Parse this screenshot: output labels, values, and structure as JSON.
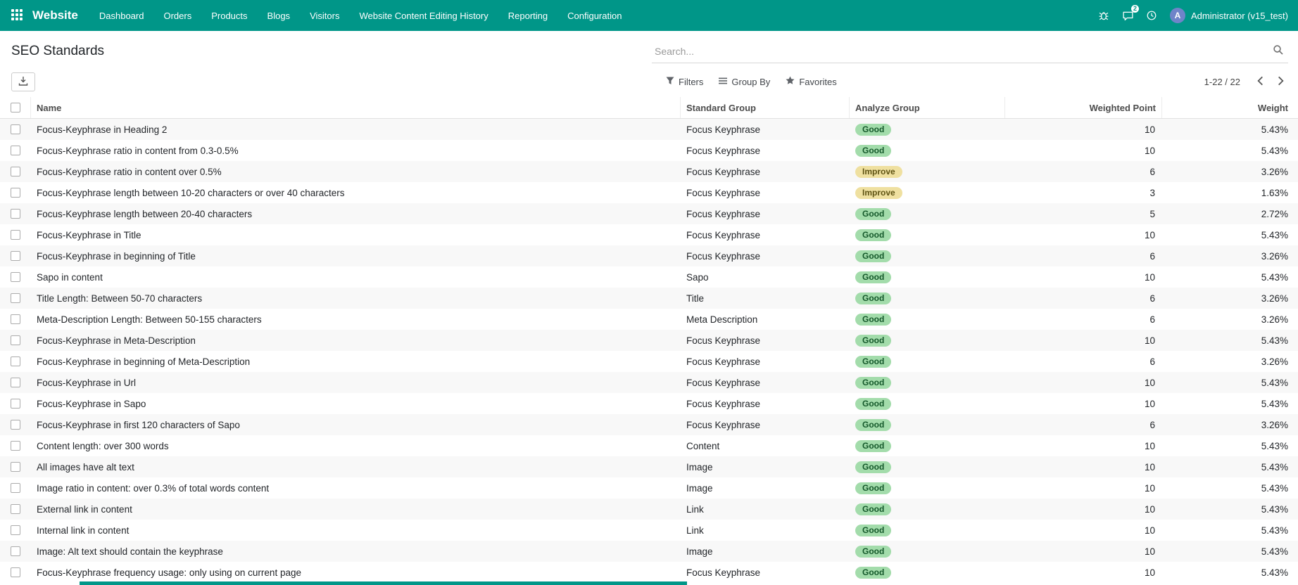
{
  "colors": {
    "accent": "#009688",
    "good_bg": "#a3dcab",
    "good_text": "#14582a",
    "improve_bg": "#efe0a0",
    "improve_text": "#5f5313"
  },
  "nav": {
    "brand": "Website",
    "items": [
      "Dashboard",
      "Orders",
      "Products",
      "Blogs",
      "Visitors",
      "Website Content Editing History",
      "Reporting",
      "Configuration"
    ],
    "message_count": "2",
    "avatar_letter": "A",
    "user": "Administrator (v15_test)"
  },
  "control_panel": {
    "title": "SEO Standards",
    "search_placeholder": "Search...",
    "filters": "Filters",
    "group_by": "Group By",
    "favorites": "Favorites",
    "pager": "1-22 / 22"
  },
  "table": {
    "columns": [
      "Name",
      "Standard Group",
      "Analyze Group",
      "Weighted Point",
      "Weight"
    ],
    "rows": [
      {
        "name": "Focus-Keyphrase in Heading 2",
        "group": "Focus Keyphrase",
        "analyze": "Good",
        "type": "good",
        "point": "10",
        "weight": "5.43%"
      },
      {
        "name": "Focus-Keyphrase ratio in content from 0.3-0.5%",
        "group": "Focus Keyphrase",
        "analyze": "Good",
        "type": "good",
        "point": "10",
        "weight": "5.43%"
      },
      {
        "name": "Focus-Keyphrase ratio in content over 0.5%",
        "group": "Focus Keyphrase",
        "analyze": "Improve",
        "type": "improve",
        "point": "6",
        "weight": "3.26%"
      },
      {
        "name": "Focus-Keyphrase length between 10-20 characters or over 40 characters",
        "group": "Focus Keyphrase",
        "analyze": "Improve",
        "type": "improve",
        "point": "3",
        "weight": "1.63%"
      },
      {
        "name": "Focus-Keyphrase length between 20-40 characters",
        "group": "Focus Keyphrase",
        "analyze": "Good",
        "type": "good",
        "point": "5",
        "weight": "2.72%"
      },
      {
        "name": "Focus-Keyphrase in Title",
        "group": "Focus Keyphrase",
        "analyze": "Good",
        "type": "good",
        "point": "10",
        "weight": "5.43%"
      },
      {
        "name": "Focus-Keyphrase in beginning of Title",
        "group": "Focus Keyphrase",
        "analyze": "Good",
        "type": "good",
        "point": "6",
        "weight": "3.26%"
      },
      {
        "name": "Sapo in content",
        "group": "Sapo",
        "analyze": "Good",
        "type": "good",
        "point": "10",
        "weight": "5.43%"
      },
      {
        "name": "Title Length: Between 50-70 characters",
        "group": "Title",
        "analyze": "Good",
        "type": "good",
        "point": "6",
        "weight": "3.26%"
      },
      {
        "name": "Meta-Description Length: Between 50-155 characters",
        "group": "Meta Description",
        "analyze": "Good",
        "type": "good",
        "point": "6",
        "weight": "3.26%"
      },
      {
        "name": "Focus-Keyphrase in Meta-Description",
        "group": "Focus Keyphrase",
        "analyze": "Good",
        "type": "good",
        "point": "10",
        "weight": "5.43%"
      },
      {
        "name": "Focus-Keyphrase in beginning of Meta-Description",
        "group": "Focus Keyphrase",
        "analyze": "Good",
        "type": "good",
        "point": "6",
        "weight": "3.26%"
      },
      {
        "name": "Focus-Keyphrase in Url",
        "group": "Focus Keyphrase",
        "analyze": "Good",
        "type": "good",
        "point": "10",
        "weight": "5.43%"
      },
      {
        "name": "Focus-Keyphrase in Sapo",
        "group": "Focus Keyphrase",
        "analyze": "Good",
        "type": "good",
        "point": "10",
        "weight": "5.43%"
      },
      {
        "name": "Focus-Keyphrase in first 120 characters of Sapo",
        "group": "Focus Keyphrase",
        "analyze": "Good",
        "type": "good",
        "point": "6",
        "weight": "3.26%"
      },
      {
        "name": "Content length: over 300 words",
        "group": "Content",
        "analyze": "Good",
        "type": "good",
        "point": "10",
        "weight": "5.43%"
      },
      {
        "name": "All images have alt text",
        "group": "Image",
        "analyze": "Good",
        "type": "good",
        "point": "10",
        "weight": "5.43%"
      },
      {
        "name": "Image ratio in content: over 0.3% of total words content",
        "group": "Image",
        "analyze": "Good",
        "type": "good",
        "point": "10",
        "weight": "5.43%"
      },
      {
        "name": "External link in content",
        "group": "Link",
        "analyze": "Good",
        "type": "good",
        "point": "10",
        "weight": "5.43%"
      },
      {
        "name": "Internal link in content",
        "group": "Link",
        "analyze": "Good",
        "type": "good",
        "point": "10",
        "weight": "5.43%"
      },
      {
        "name": "Image: Alt text should contain the keyphrase",
        "group": "Image",
        "analyze": "Good",
        "type": "good",
        "point": "10",
        "weight": "5.43%"
      },
      {
        "name": "Focus-Keyphrase frequency usage: only using on current page",
        "group": "Focus Keyphrase",
        "analyze": "Good",
        "type": "good",
        "point": "10",
        "weight": "5.43%"
      }
    ]
  }
}
